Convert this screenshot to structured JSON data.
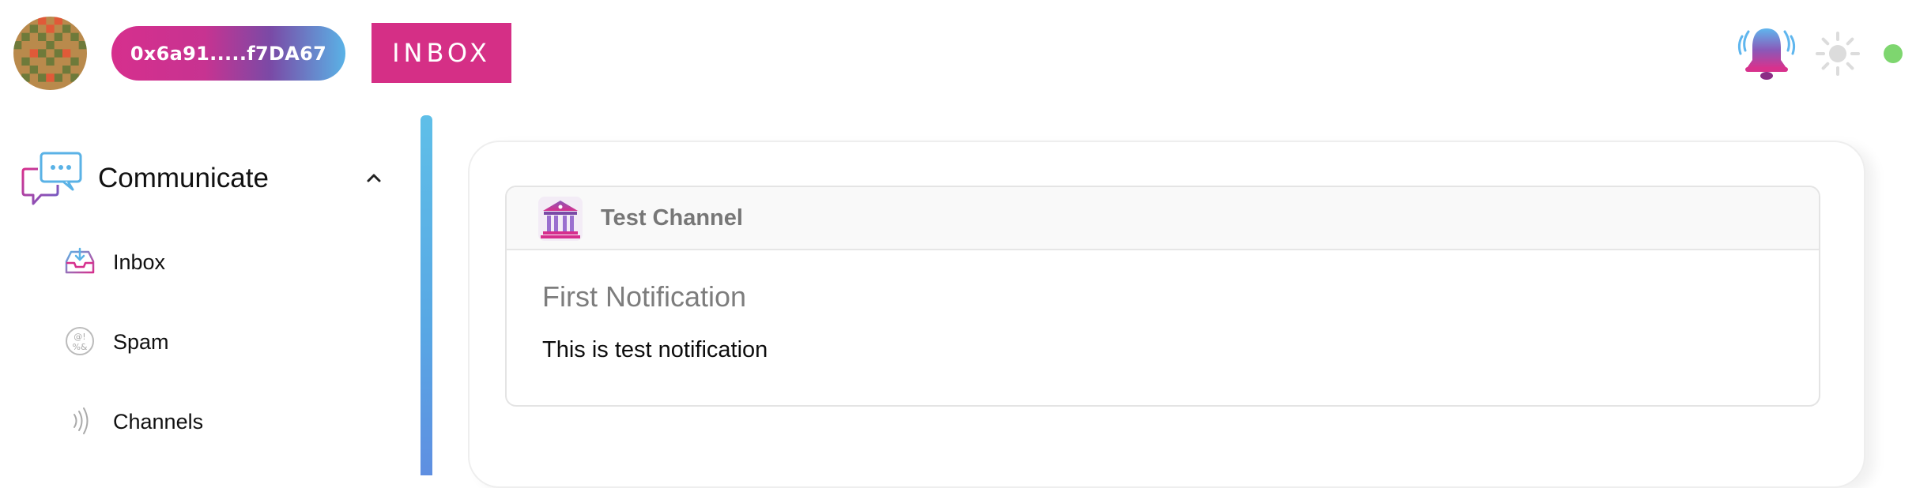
{
  "header": {
    "avatar": {
      "icon": "identicon-avatar"
    },
    "wallet_address": "0x6a91.....f7DA67",
    "page_badge": "INBOX",
    "notifications_icon": "bell-icon",
    "theme_icon": "sun-icon",
    "connection_status": {
      "icon": "status-dot",
      "color": "#7ed66f"
    }
  },
  "sidebar": {
    "section": {
      "title": "Communicate",
      "icon": "chat-bubbles-icon",
      "expanded": true
    },
    "items": [
      {
        "label": "Inbox",
        "icon": "inbox-tray-icon"
      },
      {
        "label": "Spam",
        "icon": "spam-icon"
      },
      {
        "label": "Channels",
        "icon": "broadcast-icon"
      }
    ]
  },
  "main": {
    "notifications": [
      {
        "channel_name": "Test Channel",
        "channel_icon": "bank-building-icon",
        "title": "First Notification",
        "body": "This is test notification"
      }
    ]
  },
  "colors": {
    "brand_pink": "#d52f86",
    "brand_blue": "#5ab2e6",
    "status_green": "#7ed66f"
  }
}
